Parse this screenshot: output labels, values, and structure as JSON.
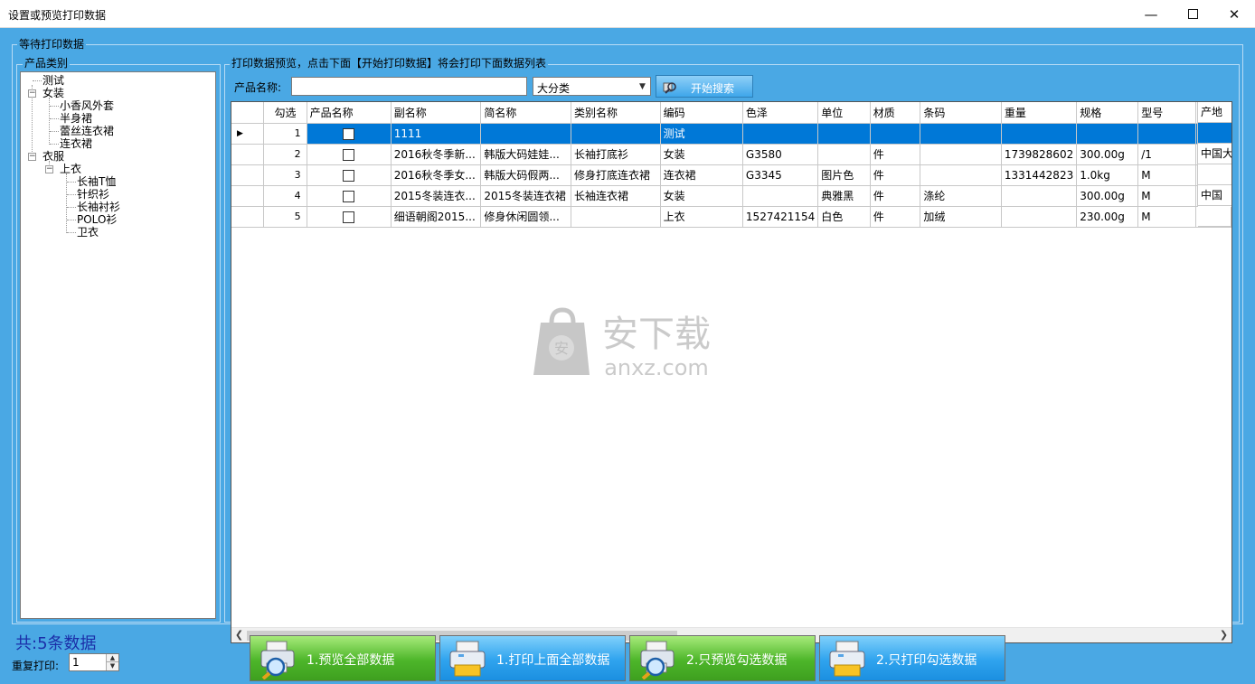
{
  "window": {
    "title": "设置或预览打印数据",
    "min_icon": "minimize-icon",
    "max_icon": "maximize-icon",
    "close_icon": "close-icon"
  },
  "outer_group_label": "等待打印数据",
  "category_panel": {
    "label": "产品类别",
    "tree": [
      "测试",
      "女装",
      "小香风外套",
      "半身裙",
      "蕾丝连衣裙",
      "连衣裙",
      "衣服",
      "上衣",
      "长袖T恤",
      "针织衫",
      "长袖衬衫",
      "POLO衫",
      "卫衣"
    ]
  },
  "preview_panel": {
    "label": "打印数据预览，点击下面【开始打印数据】将会打印下面数据列表"
  },
  "search": {
    "label": "产品名称:",
    "input_value": "",
    "category_select": "大分类",
    "button_label": "开始搜索"
  },
  "grid": {
    "columns": [
      "勾选",
      "产品名称",
      "副名称",
      "简名称",
      "类别名称",
      "编码",
      "色泽",
      "单位",
      "材质",
      "条码",
      "重量",
      "规格",
      "型号",
      "产地"
    ],
    "rows": [
      {
        "num": "1",
        "product": "1111",
        "subname": "",
        "short": "",
        "category": "测试",
        "code": "",
        "color": "",
        "unit": "",
        "material": "",
        "barcode": "",
        "weight": "",
        "spec": "",
        "model": "",
        "origin": ""
      },
      {
        "num": "2",
        "product": "2016秋冬季新...",
        "subname": "韩版大码娃娃...",
        "short": "长袖打底衫",
        "category": "女装",
        "code": "G3580",
        "color": "",
        "unit": "件",
        "material": "",
        "barcode": "1739828602",
        "weight": "300.00g",
        "spec": "/1",
        "model": "",
        "origin": "中国大"
      },
      {
        "num": "3",
        "product": "2016秋冬季女...",
        "subname": "韩版大码假两...",
        "short": "修身打底连衣裙",
        "category": "连衣裙",
        "code": "G3345",
        "color": "图片色",
        "unit": "件",
        "material": "",
        "barcode": "1331442823",
        "weight": "1.0kg",
        "spec": "M",
        "model": "",
        "origin": ""
      },
      {
        "num": "4",
        "product": "2015冬装连衣...",
        "subname": "2015冬装连衣裙",
        "short": "长袖连衣裙",
        "category": "女装",
        "code": "",
        "color": "典雅黑",
        "unit": "件",
        "material": "涤纶",
        "barcode": "",
        "weight": "300.00g",
        "spec": "M",
        "model": "",
        "origin": "中国"
      },
      {
        "num": "5",
        "product": "细语朝阁2015...",
        "subname": "修身休闲圆领...",
        "short": "",
        "category": "上衣",
        "code": "1527421154",
        "color": "白色",
        "unit": "件",
        "material": "加绒",
        "barcode": "",
        "weight": "230.00g",
        "spec": "M",
        "model": "",
        "origin": ""
      }
    ],
    "selected_row": 1,
    "scroll_left_icon": "scroll-left-icon",
    "scroll_right_icon": "scroll-right-icon"
  },
  "watermark": {
    "text_cn": "安下载",
    "text_en": "anxz.com",
    "badge": "安"
  },
  "footer": {
    "total": "共:5条数据",
    "repeat_label": "重复打印:",
    "repeat_value": "1",
    "buttons": [
      {
        "label": "1.预览全部数据",
        "icon": "preview-printer-icon",
        "color": "#4db62a"
      },
      {
        "label": "1.打印上面全部数据",
        "icon": "printer-icon",
        "color": "#2fa3ee"
      },
      {
        "label": "2.只预览勾选数据",
        "icon": "preview-printer-icon",
        "color": "#4db62a"
      },
      {
        "label": "2.只打印勾选数据",
        "icon": "printer-icon",
        "color": "#2fa3ee"
      }
    ]
  },
  "colors": {
    "background": "#4aa8e4",
    "selection": "#0078d7",
    "total_text": "#1b2ea8"
  }
}
